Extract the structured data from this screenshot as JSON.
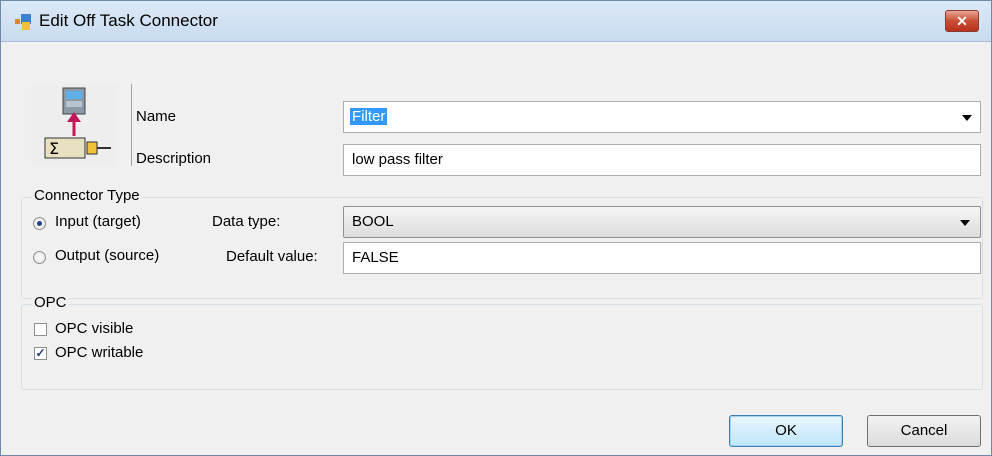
{
  "window": {
    "title": "Edit Off Task Connector",
    "close_label": "✕"
  },
  "form": {
    "name_label": "Name",
    "name_value": "Filter",
    "description_label": "Description",
    "description_value": "low pass filter"
  },
  "connector_type": {
    "title": "Connector Type",
    "input_label": "Input (target)",
    "output_label": "Output (source)",
    "selected": "input",
    "data_type_label": "Data type:",
    "data_type_value": "BOOL",
    "default_value_label": "Default value:",
    "default_value": "FALSE"
  },
  "opc": {
    "title": "OPC",
    "visible_label": "OPC visible",
    "visible_checked": false,
    "writable_label": "OPC writable",
    "writable_checked": true
  },
  "buttons": {
    "ok": "OK",
    "cancel": "Cancel"
  }
}
